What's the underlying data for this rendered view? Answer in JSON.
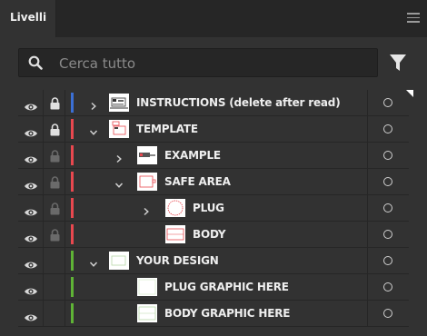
{
  "panel": {
    "tab_label": "Livelli"
  },
  "search": {
    "placeholder": "Cerca tutto",
    "value": ""
  },
  "colors": {
    "blue": "#3b6fd4",
    "red": "#e8484f",
    "green": "#5fb336"
  },
  "icons": {
    "visibility": "eye-icon",
    "lock": "lock-icon",
    "expand": "chevron-icon",
    "target": "target-circle-icon",
    "filter": "filter-icon",
    "search": "search-icon",
    "menu": "hamburger-menu-icon"
  },
  "layers": [
    {
      "name": "INSTRUCTIONS (delete after read)",
      "depth": 0,
      "expandable": true,
      "expanded": false,
      "locked": true,
      "lock_inherited": false,
      "color": "blue",
      "thumb": "instructions"
    },
    {
      "name": "TEMPLATE",
      "depth": 0,
      "expandable": true,
      "expanded": true,
      "locked": true,
      "lock_inherited": false,
      "color": "red",
      "thumb": "template"
    },
    {
      "name": "EXAMPLE",
      "depth": 1,
      "expandable": true,
      "expanded": false,
      "locked": true,
      "lock_inherited": true,
      "color": "red",
      "thumb": "example"
    },
    {
      "name": "SAFE AREA",
      "depth": 1,
      "expandable": true,
      "expanded": true,
      "locked": true,
      "lock_inherited": true,
      "color": "red",
      "thumb": "safe-area"
    },
    {
      "name": "PLUG",
      "depth": 2,
      "expandable": true,
      "expanded": false,
      "locked": true,
      "lock_inherited": true,
      "color": "red",
      "thumb": "plug"
    },
    {
      "name": "BODY",
      "depth": 2,
      "expandable": false,
      "expanded": false,
      "locked": true,
      "lock_inherited": true,
      "color": "red",
      "thumb": "body"
    },
    {
      "name": "YOUR DESIGN",
      "depth": 0,
      "expandable": true,
      "expanded": true,
      "locked": false,
      "lock_inherited": false,
      "color": "green",
      "thumb": "your-design"
    },
    {
      "name": "PLUG GRAPHIC HERE",
      "depth": 1,
      "expandable": false,
      "expanded": false,
      "locked": false,
      "lock_inherited": false,
      "color": "green",
      "thumb": "plug-graphic"
    },
    {
      "name": "BODY GRAPHIC HERE",
      "depth": 1,
      "expandable": false,
      "expanded": false,
      "locked": false,
      "lock_inherited": false,
      "color": "green",
      "thumb": "body-graphic"
    }
  ]
}
